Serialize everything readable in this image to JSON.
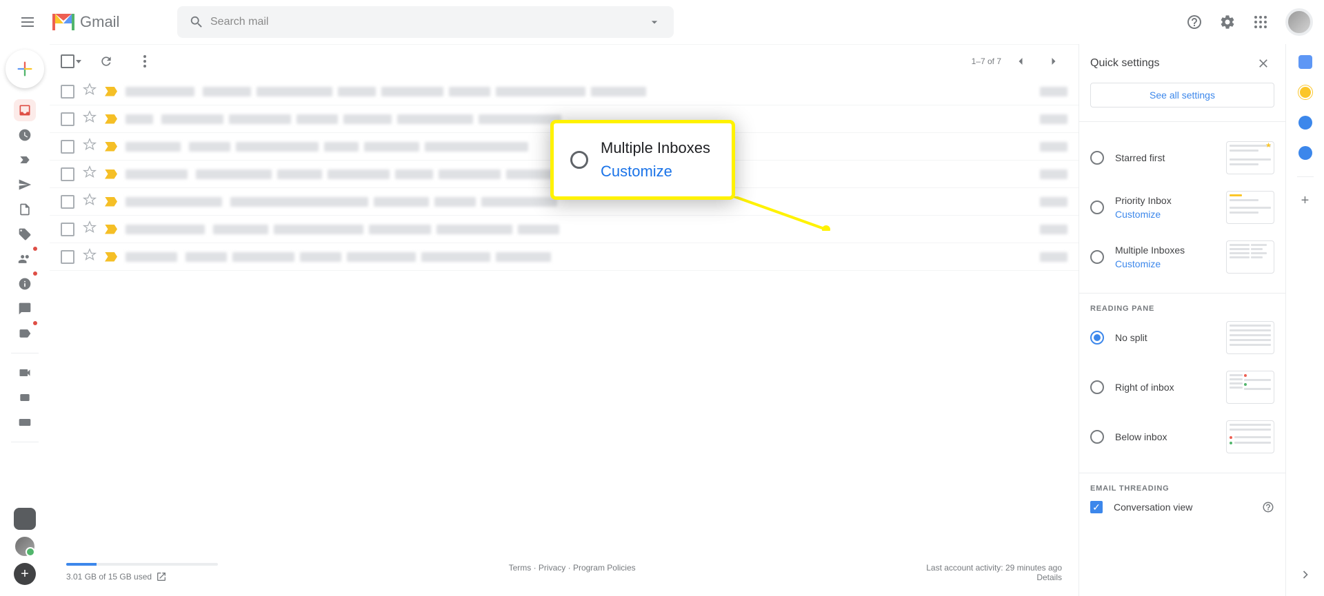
{
  "header": {
    "logo_text": "Gmail",
    "search_placeholder": "Search mail"
  },
  "toolbar": {
    "page_indicator": "1–7 of 7"
  },
  "footer": {
    "storage": "3.01 GB of 15 GB used",
    "terms": "Terms",
    "privacy": "Privacy",
    "policies": "Program Policies",
    "activity": "Last account activity: 29 minutes ago",
    "details": "Details"
  },
  "quick_settings": {
    "title": "Quick settings",
    "see_all": "See all settings",
    "inbox_type": {
      "starred_first": "Starred first",
      "priority_inbox": "Priority Inbox",
      "priority_customize": "Customize",
      "multiple_inboxes": "Multiple Inboxes",
      "multiple_customize": "Customize"
    },
    "reading_pane": {
      "heading": "READING PANE",
      "no_split": "No split",
      "right": "Right of inbox",
      "below": "Below inbox"
    },
    "threading": {
      "heading": "EMAIL THREADING",
      "conversation": "Conversation view"
    }
  },
  "callout": {
    "title": "Multiple Inboxes",
    "sub": "Customize"
  }
}
